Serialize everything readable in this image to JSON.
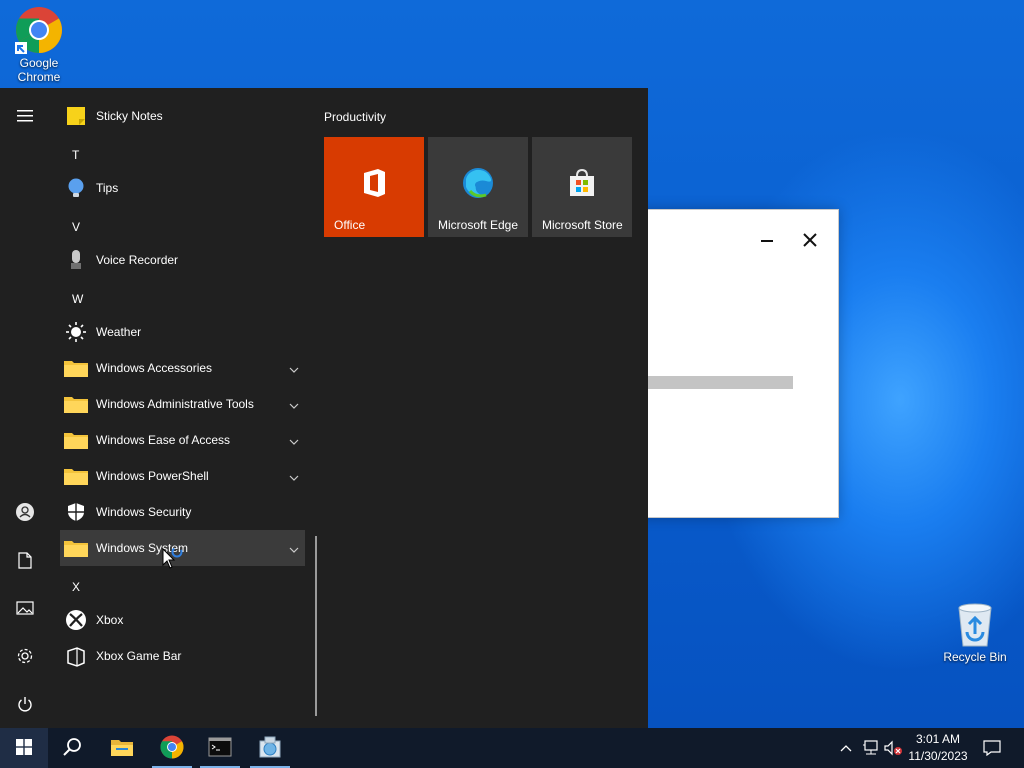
{
  "desktop": {
    "icons": [
      {
        "label_line1": "Google",
        "label_line2": "Chrome",
        "icon": "chrome-icon"
      },
      {
        "label": "Recycle Bin",
        "icon": "recycle-bin-icon"
      }
    ]
  },
  "start_menu": {
    "rail": {
      "menu_icon": "hamburger-icon",
      "user_icon": "user-icon",
      "documents_icon": "document-icon",
      "pictures_icon": "pictures-icon",
      "settings_icon": "gear-icon",
      "power_icon": "power-icon"
    },
    "apps": {
      "sticky_notes": "Sticky Notes",
      "letter_t": "T",
      "tips": "Tips",
      "letter_v": "V",
      "voice_recorder": "Voice Recorder",
      "letter_w": "W",
      "weather": "Weather",
      "windows_accessories": "Windows Accessories",
      "windows_admin_tools": "Windows Administrative Tools",
      "windows_ease_of_access": "Windows Ease of Access",
      "windows_powershell": "Windows PowerShell",
      "windows_security": "Windows Security",
      "windows_system": "Windows System",
      "letter_x": "X",
      "xbox": "Xbox",
      "xbox_game_bar": "Xbox Game Bar"
    },
    "tiles": {
      "group_title": "Productivity",
      "items": [
        {
          "label": "Office",
          "color": "#d83b01",
          "icon": "office-icon"
        },
        {
          "label": "Microsoft Edge",
          "color": "#3a3a3a",
          "icon": "edge-icon"
        },
        {
          "label": "Microsoft Store",
          "color": "#3a3a3a",
          "icon": "store-icon"
        }
      ]
    }
  },
  "background_window": {
    "minimize_icon": "minimize-icon",
    "close_icon": "close-icon"
  },
  "taskbar": {
    "start_icon": "windows-logo-icon",
    "search_icon": "search-icon",
    "pinned": [
      "file-explorer-icon",
      "chrome-icon",
      "terminal-icon",
      "installer-icon"
    ],
    "tray": {
      "chevron_icon": "chevron-up-icon",
      "network_icon": "network-icon",
      "volume_icon": "volume-muted-icon",
      "time": "3:01 AM",
      "date": "11/30/2023",
      "notification_icon": "notification-icon"
    }
  },
  "colors": {
    "start_bg": "#202020",
    "office_tile": "#d83b01",
    "folder": "#f3c33b",
    "taskbar": "#101a2a"
  }
}
